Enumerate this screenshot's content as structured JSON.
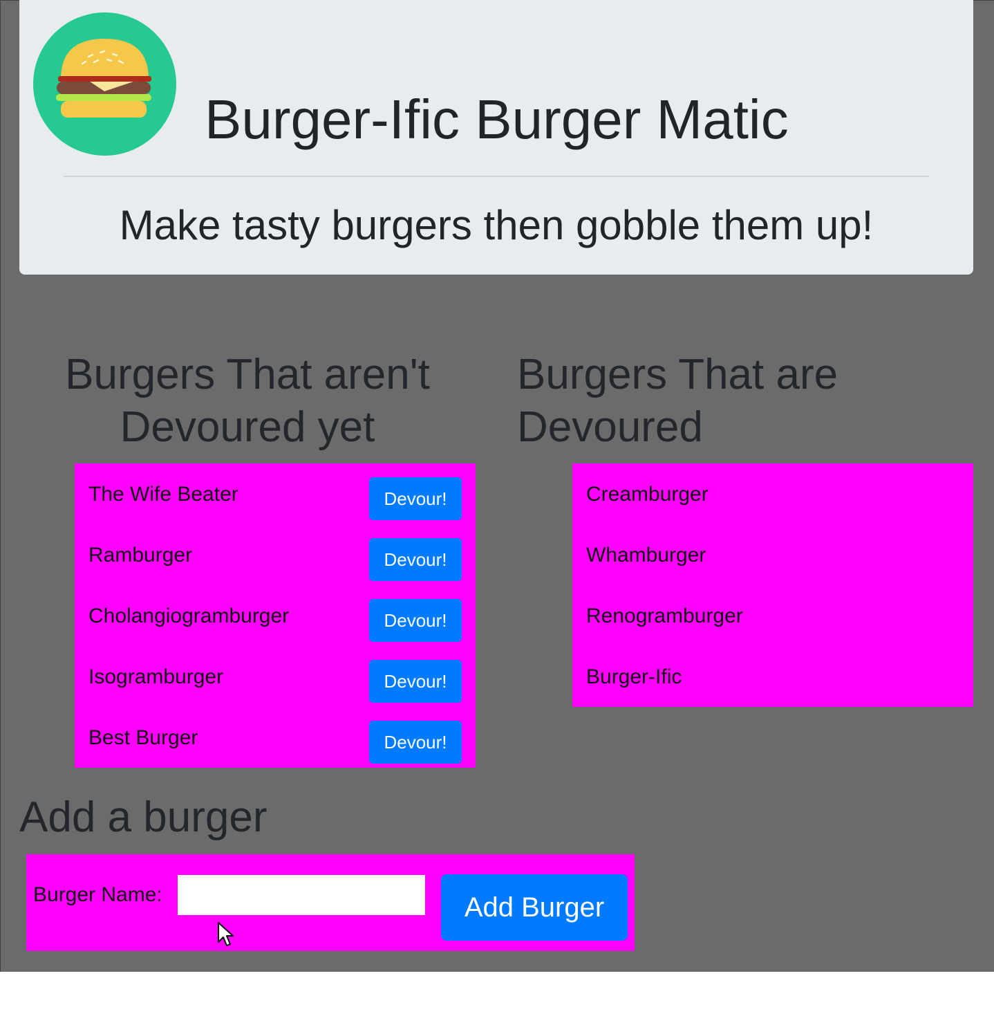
{
  "header": {
    "logo_icon": "burger-icon",
    "title": "Burger-Ific Burger Matic",
    "tagline": "Make tasty burgers then gobble them up!"
  },
  "not_devoured": {
    "heading_line1": "Burgers That aren't",
    "heading_line2": "Devoured yet",
    "items": [
      {
        "name": "The Wife Beater",
        "button": "Devour!"
      },
      {
        "name": "Ramburger",
        "button": "Devour!"
      },
      {
        "name": "Cholangiogramburger",
        "button": "Devour!"
      },
      {
        "name": "Isogramburger",
        "button": "Devour!"
      },
      {
        "name": "Best Burger",
        "button": "Devour!"
      }
    ]
  },
  "devoured": {
    "heading_line1": "Burgers That are",
    "heading_line2": "Devoured",
    "items": [
      {
        "name": "Creamburger"
      },
      {
        "name": "Whamburger"
      },
      {
        "name": "Renogramburger"
      },
      {
        "name": "Burger-Ific"
      }
    ]
  },
  "add_form": {
    "heading": "Add a burger",
    "label": "Burger Name:",
    "input_value": "",
    "submit_label": "Add Burger"
  },
  "colors": {
    "page_bg": "#6b6b6b",
    "jumbotron_bg": "#e9ecef",
    "list_bg": "#ff00ff",
    "button_blue": "#007bff",
    "logo_green": "#26c98f"
  }
}
